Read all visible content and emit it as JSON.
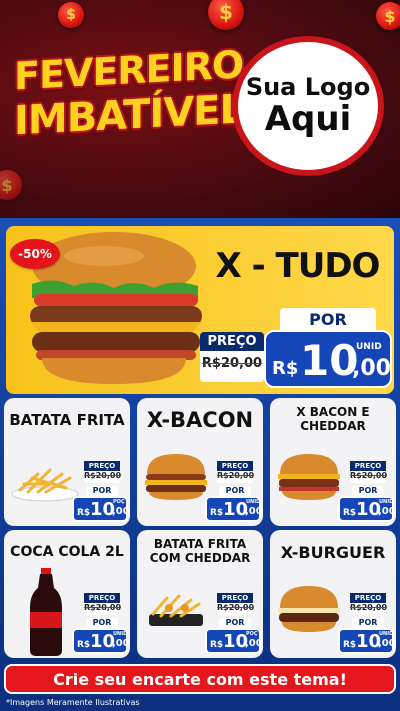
{
  "header": {
    "title_line1": "FEVEREIRO",
    "title_line2": "IMBATÍVEL",
    "logo_line1": "Sua Logo",
    "logo_line2": "Aqui",
    "coin_symbol": "$"
  },
  "featured": {
    "discount": "-50%",
    "name": "X - TUDO",
    "preco_label": "PREÇO",
    "old_price": "R$20,00",
    "por_label": "POR",
    "currency": "R$",
    "price_int": "10",
    "price_cents": ",00",
    "unit": "UNID"
  },
  "cards": [
    {
      "name": "BATATA FRITA",
      "preco_label": "PREÇO",
      "old_price": "R$20,00",
      "por_label": "POR",
      "currency": "R$",
      "price_int": "10",
      "price_cents": ",00",
      "unit": "POÇ",
      "icon": "fries-icon"
    },
    {
      "name": "X-BACON",
      "preco_label": "PREÇO",
      "old_price": "R$20,00",
      "por_label": "POR",
      "currency": "R$",
      "price_int": "10",
      "price_cents": ",00",
      "unit": "UNID",
      "icon": "burger-icon"
    },
    {
      "name": "X BACON E CHEDDAR",
      "preco_label": "PREÇO",
      "old_price": "R$20,00",
      "por_label": "POR",
      "currency": "R$",
      "price_int": "10",
      "price_cents": ",00",
      "unit": "UNID",
      "icon": "burger-icon"
    },
    {
      "name": "COCA COLA 2L",
      "preco_label": "PREÇO",
      "old_price": "R$20,00",
      "por_label": "POR",
      "currency": "R$",
      "price_int": "10",
      "price_cents": ",00",
      "unit": "UNID",
      "icon": "soda-bottle-icon"
    },
    {
      "name": "BATATA FRITA COM CHEDDAR",
      "preco_label": "PREÇO",
      "old_price": "R$20,00",
      "por_label": "POR",
      "currency": "R$",
      "price_int": "10",
      "price_cents": ",00",
      "unit": "POÇ",
      "icon": "fries-icon"
    },
    {
      "name": "X-BURGUER",
      "preco_label": "PREÇO",
      "old_price": "R$20,00",
      "por_label": "POR",
      "currency": "R$",
      "price_int": "10",
      "price_cents": ",00",
      "unit": "UNID",
      "icon": "burger-icon"
    }
  ],
  "cta": {
    "label": "Crie seu encarte com este tema!"
  },
  "footnote": "*Imagens Meramente Ilustrativas",
  "colors": {
    "brand_red": "#e6171c",
    "brand_yellow": "#ffd21f",
    "brand_blue": "#1546b8"
  }
}
